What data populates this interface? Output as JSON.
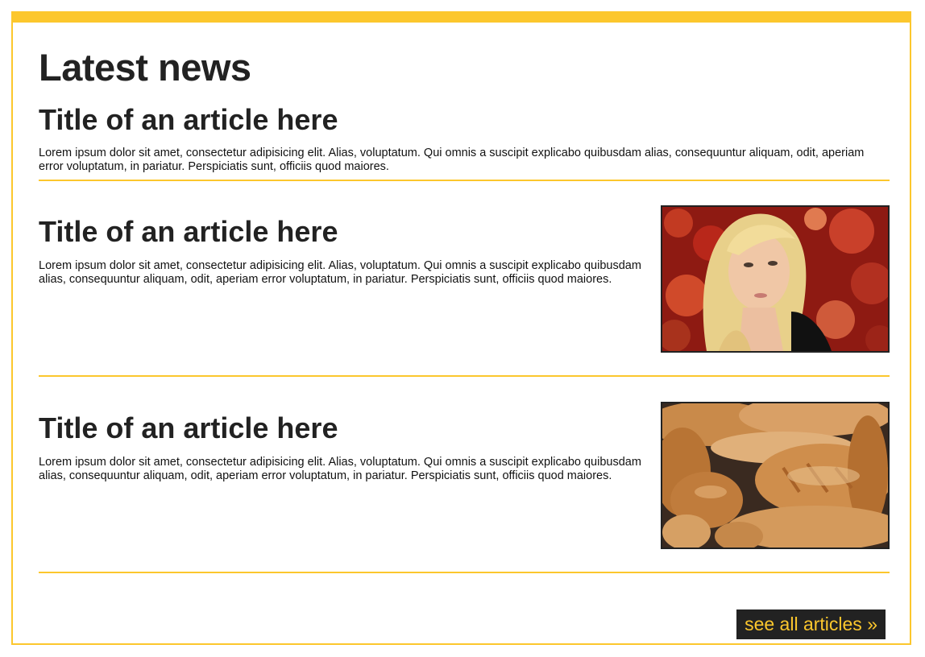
{
  "section": {
    "title": "Latest news"
  },
  "articles": [
    {
      "title": "Title of an article here",
      "body": "Lorem ipsum dolor sit amet, consectetur adipisicing elit. Alias, voluptatum. Qui omnis a suscipit explicabo quibusdam alias, consequuntur aliquam, odit, aperiam error voluptatum, in pariatur. Perspiciatis sunt, officiis quod maiores."
    },
    {
      "title": "Title of an article here",
      "body": "Lorem ipsum dolor sit amet, consectetur adipisicing elit. Alias, voluptatum. Qui omnis a suscipit explicabo quibusdam alias, consequuntur aliquam, odit, aperiam error voluptatum, in pariatur. Perspiciatis sunt, officiis quod maiores.",
      "image": "woman-portrait-photo"
    },
    {
      "title": "Title of an article here",
      "body": "Lorem ipsum dolor sit amet, consectetur adipisicing elit. Alias, voluptatum. Qui omnis a suscipit explicabo quibusdam alias, consequuntur aliquam, odit, aperiam error voluptatum, in pariatur. Perspiciatis sunt, officiis quod maiores.",
      "image": "bread-loaves-photo"
    }
  ],
  "footer": {
    "see_all_label": "see all articles »"
  },
  "colors": {
    "accent": "#fcc72d",
    "dark": "#222222",
    "background": "#ffffff"
  }
}
